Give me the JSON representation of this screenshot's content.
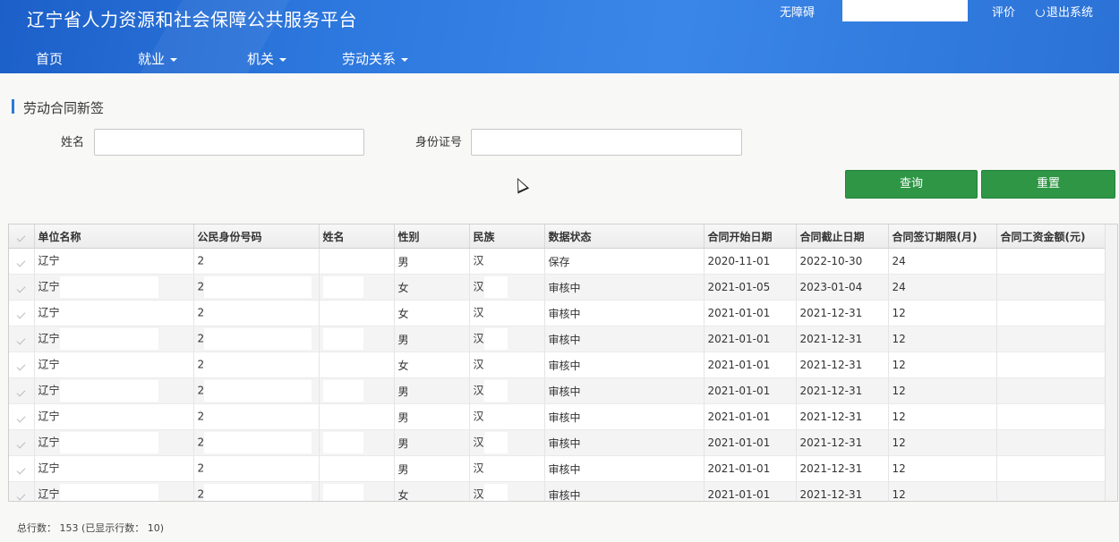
{
  "header": {
    "site_title": "辽宁省人力资源和社会保障公共服务平台",
    "accessibility_link": "无障碍",
    "search_value": "",
    "rate_link": "评价",
    "logout_link": "退出系统",
    "nav": [
      {
        "label": "首页"
      },
      {
        "label": "就业"
      },
      {
        "label": "机关"
      },
      {
        "label": "劳动关系"
      }
    ]
  },
  "page": {
    "section_title": "劳动合同新签",
    "name_label": "姓名",
    "name_value": "",
    "id_label": "身份证号",
    "id_value": "",
    "query_button": "查询",
    "reset_button": "重置"
  },
  "table": {
    "columns": [
      "单位名称",
      "公民身份号码",
      "姓名",
      "性别",
      "民族",
      "数据状态",
      "合同开始日期",
      "合同截止日期",
      "合同签订期限(月)",
      "合同工资金额(元)"
    ],
    "rows": [
      {
        "unit": "辽宁",
        "idno": "2",
        "name": "",
        "gender": "男",
        "ethnic": "汉",
        "status": "保存",
        "start": "2020-11-01",
        "end": "2022-10-30",
        "term": "24",
        "salary": ""
      },
      {
        "unit": "辽宁",
        "idno": "2",
        "name": "",
        "gender": "女",
        "ethnic": "汉",
        "status": "审核中",
        "start": "2021-01-05",
        "end": "2023-01-04",
        "term": "24",
        "salary": ""
      },
      {
        "unit": "辽宁",
        "idno": "2",
        "name": "",
        "gender": "女",
        "ethnic": "汉",
        "status": "审核中",
        "start": "2021-01-01",
        "end": "2021-12-31",
        "term": "12",
        "salary": ""
      },
      {
        "unit": "辽宁",
        "idno": "2",
        "name": "",
        "gender": "男",
        "ethnic": "汉",
        "status": "审核中",
        "start": "2021-01-01",
        "end": "2021-12-31",
        "term": "12",
        "salary": ""
      },
      {
        "unit": "辽宁",
        "idno": "2",
        "name": "",
        "gender": "女",
        "ethnic": "汉",
        "status": "审核中",
        "start": "2021-01-01",
        "end": "2021-12-31",
        "term": "12",
        "salary": ""
      },
      {
        "unit": "辽宁",
        "idno": "2",
        "name": "",
        "gender": "男",
        "ethnic": "汉",
        "status": "审核中",
        "start": "2021-01-01",
        "end": "2021-12-31",
        "term": "12",
        "salary": ""
      },
      {
        "unit": "辽宁",
        "idno": "2",
        "name": "",
        "gender": "男",
        "ethnic": "汉",
        "status": "审核中",
        "start": "2021-01-01",
        "end": "2021-12-31",
        "term": "12",
        "salary": ""
      },
      {
        "unit": "辽宁",
        "idno": "2",
        "name": "",
        "gender": "男",
        "ethnic": "汉",
        "status": "审核中",
        "start": "2021-01-01",
        "end": "2021-12-31",
        "term": "12",
        "salary": ""
      },
      {
        "unit": "辽宁",
        "idno": "2",
        "name": "",
        "gender": "男",
        "ethnic": "汉",
        "status": "审核中",
        "start": "2021-01-01",
        "end": "2021-12-31",
        "term": "12",
        "salary": ""
      },
      {
        "unit": "辽宁",
        "idno": "2",
        "name": "",
        "gender": "女",
        "ethnic": "汉",
        "status": "审核中",
        "start": "2021-01-01",
        "end": "2021-12-31",
        "term": "12",
        "salary": ""
      }
    ]
  },
  "footer": {
    "total_text": "总行数： 153 (已显示行数： 10)"
  },
  "colors": {
    "header_blue": "#2d78de",
    "button_green": "#2e9645",
    "section_accent": "#2c79d8"
  }
}
